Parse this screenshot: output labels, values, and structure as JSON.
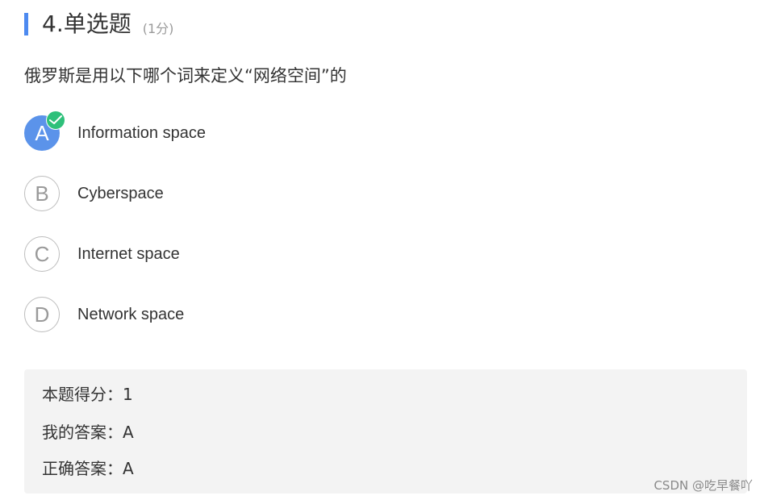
{
  "question": {
    "title": "4.单选题",
    "score": "(1分)",
    "text": "俄罗斯是用以下哪个词来定义“网络空间”的"
  },
  "options": [
    {
      "letter": "A",
      "text": "Information space",
      "selected": true
    },
    {
      "letter": "B",
      "text": "Cyberspace",
      "selected": false
    },
    {
      "letter": "C",
      "text": "Internet space",
      "selected": false
    },
    {
      "letter": "D",
      "text": "Network space",
      "selected": false
    }
  ],
  "result": {
    "score_line": "本题得分：1",
    "my_answer_line": "我的答案：A",
    "correct_answer_line": "正确答案：A"
  },
  "watermark": "CSDN @吃早餐吖",
  "colors": {
    "accent": "#4d8af0",
    "selected": "#5b93ea",
    "check": "#2ec07a",
    "panel_bg": "#f3f3f3"
  },
  "icons": {
    "check": "checkmark-icon"
  }
}
